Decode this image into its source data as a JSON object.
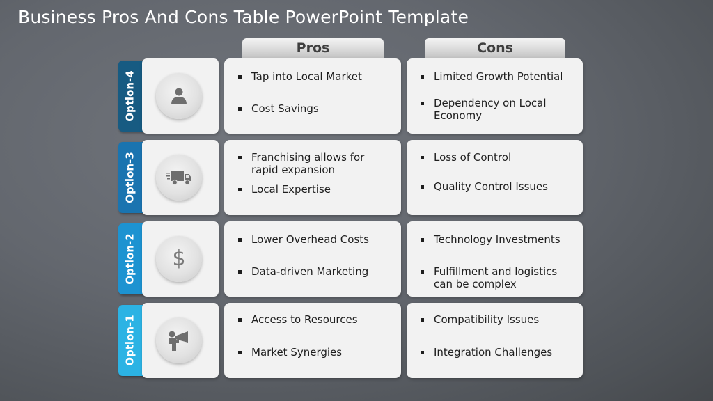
{
  "title": "Business Pros And Cons Table PowerPoint Template",
  "headers": {
    "pros": "Pros",
    "cons": "Cons"
  },
  "colors": {
    "option4": "#175b82",
    "option3": "#1a74b0",
    "option2": "#1d93d1",
    "option1": "#2cb3e4",
    "header_text": "#3f3f3f",
    "card_bg": "#f2f2f2"
  },
  "rows": [
    {
      "option": "Option-4",
      "icon": "user-icon",
      "pros": [
        "Tap into Local Market",
        "Cost Savings"
      ],
      "cons": [
        "Limited Growth Potential",
        "Dependency on Local Economy"
      ]
    },
    {
      "option": "Option-3",
      "icon": "delivery-truck-icon",
      "pros": [
        "Franchising allows for rapid expansion",
        "Local Expertise"
      ],
      "cons": [
        "Loss of Control",
        "Quality Control Issues"
      ]
    },
    {
      "option": "Option-2",
      "icon": "dollar-icon",
      "icon_glyph": "$",
      "pros": [
        "Lower Overhead Costs",
        "Data-driven Marketing"
      ],
      "cons": [
        "Technology Investments",
        "Fulfillment and logistics can be complex"
      ]
    },
    {
      "option": "Option-1",
      "icon": "megaphone-person-icon",
      "pros": [
        "Access to Resources",
        "Market Synergies"
      ],
      "cons": [
        "Compatibility Issues",
        "Integration Challenges"
      ]
    }
  ]
}
